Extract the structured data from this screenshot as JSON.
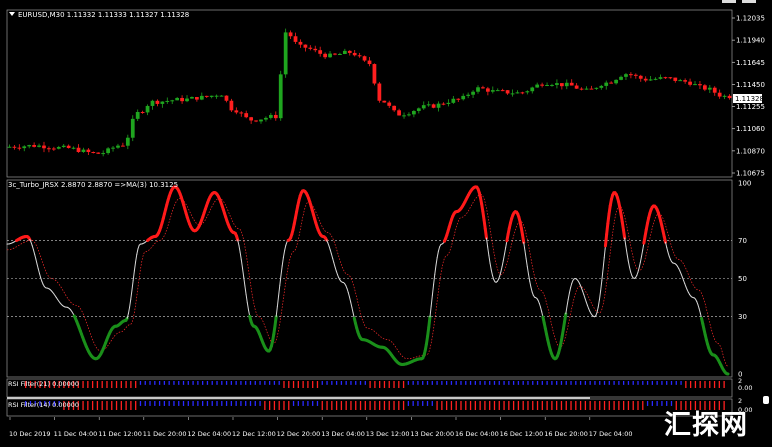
{
  "window": {
    "price_panel_title": "EURUSD,M30  1.11332 1.11333 1.11327 1.11328",
    "current_price_label": "1.11328"
  },
  "price_axis": [
    "1.12035",
    "1.11940",
    "1.11645",
    "1.11450",
    "1.11255",
    "1.11060",
    "1.10870",
    "1.10675"
  ],
  "indicator": {
    "title": "3c_Turbo_JRSX 2.8870  2.8870  =>MA(3) 10.3125",
    "levels": [
      "100",
      "70",
      "50",
      "30",
      "0"
    ],
    "colors": {
      "rising": "#ff1a1a",
      "falling": "#1a8f1a",
      "neutral": "#d8d8d8",
      "ma": "#ff2b2b"
    }
  },
  "rsi_filter_21": {
    "title": "RSI Filter(21) 0.00000",
    "axis": [
      "2",
      "0.00"
    ]
  },
  "rsi_filter_14": {
    "title": "RSI Filter(14) 0.00000",
    "axis": [
      "2",
      "0.00"
    ]
  },
  "time_axis": [
    "10 Dec 2019",
    "11 Dec 04:00",
    "11 Dec 12:00",
    "11 Dec 20:00",
    "12 Dec 04:00",
    "12 Dec 12:00",
    "12 Dec 20:00",
    "13 Dec 04:00",
    "13 Dec 12:00",
    "13 Dec 20:00",
    "16 Dec 04:00",
    "16 Dec 12:00",
    "16 Dec 20:00",
    "17 Dec 04:00"
  ],
  "colors": {
    "bull": "#1fa51f",
    "bear": "#ff1f1f",
    "filter_up": "#2a2aff",
    "filter_down": "#ff2020",
    "grid": "#cfcfcf"
  },
  "watermark": "汇探网",
  "chart_data": {
    "type": "line",
    "title": "EURUSD,M30",
    "x_ticks": [
      "10 Dec 2019",
      "11 Dec 04:00",
      "11 Dec 12:00",
      "11 Dec 20:00",
      "12 Dec 04:00",
      "12 Dec 12:00",
      "12 Dec 20:00",
      "13 Dec 04:00",
      "13 Dec 12:00",
      "13 Dec 20:00",
      "16 Dec 04:00",
      "16 Dec 12:00",
      "16 Dec 20:00",
      "17 Dec 04:00"
    ],
    "ylim": [
      1.1062,
      1.1208
    ],
    "price_key": [
      [
        0,
        1.1088
      ],
      [
        6,
        1.1089
      ],
      [
        12,
        1.1087
      ],
      [
        19,
        1.1082
      ],
      [
        24,
        1.109
      ],
      [
        27,
        1.1118
      ],
      [
        30,
        1.1128
      ],
      [
        36,
        1.113
      ],
      [
        40,
        1.1132
      ],
      [
        44,
        1.1135
      ],
      [
        46,
        1.1122
      ],
      [
        50,
        1.1112
      ],
      [
        55,
        1.1115
      ],
      [
        57,
        1.119
      ],
      [
        60,
        1.1177
      ],
      [
        66,
        1.1169
      ],
      [
        70,
        1.1172
      ],
      [
        74,
        1.1162
      ],
      [
        76,
        1.113
      ],
      [
        80,
        1.1117
      ],
      [
        86,
        1.1124
      ],
      [
        92,
        1.113
      ],
      [
        96,
        1.114
      ],
      [
        100,
        1.1137
      ],
      [
        104,
        1.1136
      ],
      [
        110,
        1.1145
      ],
      [
        114,
        1.1143
      ],
      [
        118,
        1.1138
      ],
      [
        122,
        1.1145
      ],
      [
        126,
        1.1153
      ],
      [
        130,
        1.1148
      ],
      [
        134,
        1.1149
      ],
      [
        138,
        1.1146
      ],
      [
        142,
        1.114
      ],
      [
        146,
        1.1133
      ]
    ],
    "jrsx_key": [
      [
        0,
        68
      ],
      [
        4,
        72
      ],
      [
        8,
        45
      ],
      [
        12,
        35
      ],
      [
        18,
        8
      ],
      [
        22,
        25
      ],
      [
        24,
        28
      ],
      [
        27,
        68
      ],
      [
        30,
        72
      ],
      [
        34,
        98
      ],
      [
        38,
        75
      ],
      [
        42,
        95
      ],
      [
        46,
        74
      ],
      [
        50,
        25
      ],
      [
        53,
        12
      ],
      [
        57,
        70
      ],
      [
        60,
        96
      ],
      [
        64,
        72
      ],
      [
        68,
        48
      ],
      [
        72,
        18
      ],
      [
        76,
        14
      ],
      [
        80,
        5
      ],
      [
        84,
        8
      ],
      [
        88,
        68
      ],
      [
        91,
        85
      ],
      [
        95,
        98
      ],
      [
        99,
        48
      ],
      [
        103,
        85
      ],
      [
        107,
        40
      ],
      [
        111,
        8
      ],
      [
        115,
        50
      ],
      [
        119,
        30
      ],
      [
        123,
        95
      ],
      [
        127,
        50
      ],
      [
        131,
        88
      ],
      [
        135,
        58
      ],
      [
        139,
        40
      ],
      [
        143,
        10
      ],
      [
        146,
        0
      ]
    ],
    "ma_key": [
      [
        0,
        65
      ],
      [
        5,
        70
      ],
      [
        9,
        50
      ],
      [
        14,
        36
      ],
      [
        19,
        12
      ],
      [
        23,
        22
      ],
      [
        25,
        26
      ],
      [
        28,
        64
      ],
      [
        31,
        70
      ],
      [
        35,
        92
      ],
      [
        39,
        78
      ],
      [
        43,
        92
      ],
      [
        47,
        76
      ],
      [
        51,
        30
      ],
      [
        54,
        16
      ],
      [
        58,
        64
      ],
      [
        61,
        90
      ],
      [
        65,
        74
      ],
      [
        69,
        52
      ],
      [
        73,
        24
      ],
      [
        77,
        18
      ],
      [
        81,
        8
      ],
      [
        85,
        10
      ],
      [
        89,
        62
      ],
      [
        92,
        82
      ],
      [
        96,
        94
      ],
      [
        100,
        52
      ],
      [
        104,
        80
      ],
      [
        108,
        44
      ],
      [
        112,
        14
      ],
      [
        116,
        46
      ],
      [
        120,
        32
      ],
      [
        124,
        88
      ],
      [
        128,
        54
      ],
      [
        132,
        84
      ],
      [
        136,
        60
      ],
      [
        140,
        44
      ],
      [
        144,
        16
      ],
      [
        146,
        4
      ]
    ],
    "levels": [
      100,
      70,
      50,
      30,
      0
    ]
  }
}
